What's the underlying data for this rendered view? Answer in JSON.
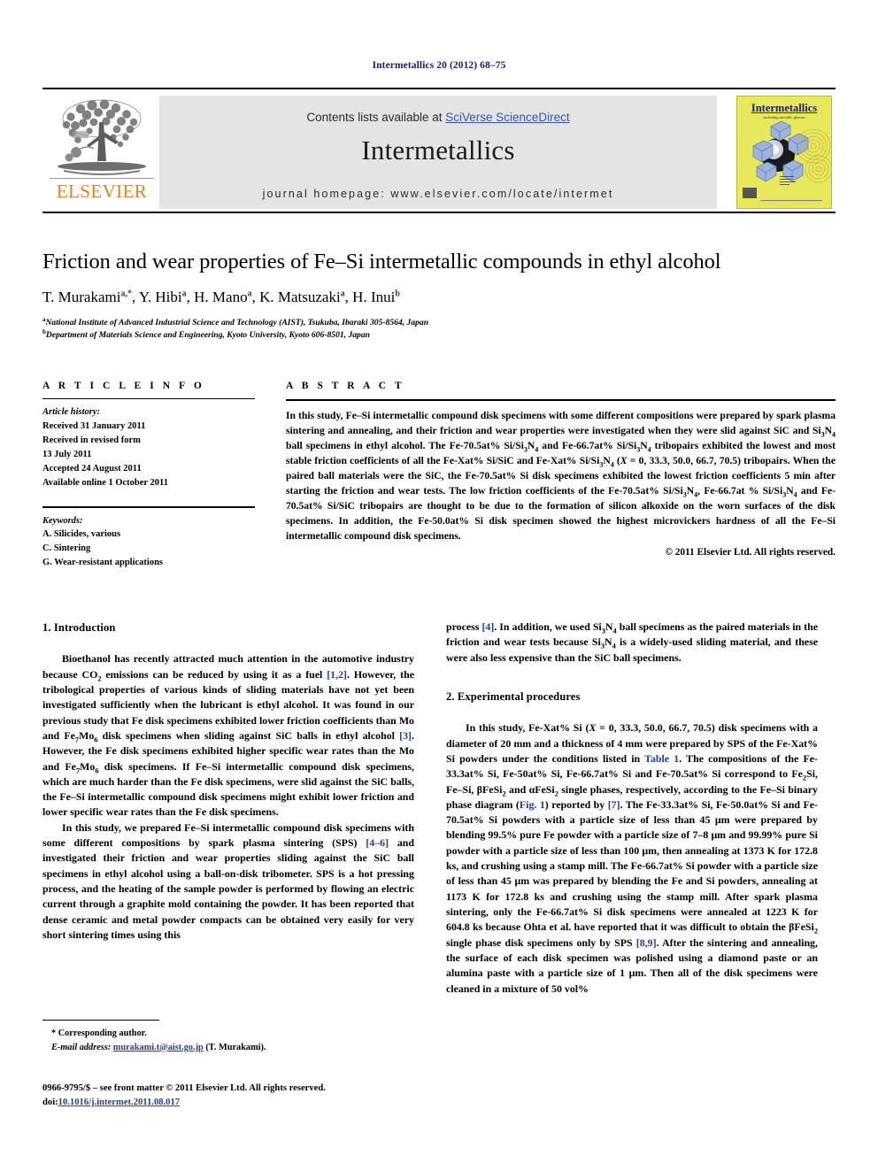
{
  "running_head": "Intermetallics 20 (2012) 68–75",
  "banner": {
    "contents_prefix": "Contents lists available at ",
    "contents_link": "SciVerse ScienceDirect",
    "journal_name": "Intermetallics",
    "homepage": "journal homepage: www.elsevier.com/locate/intermet",
    "publisher_name": "ELSEVIER",
    "cover_title": "Intermetallics",
    "cover_subtitle": "including metallic glasses"
  },
  "title": "Friction and wear properties of Fe–Si intermetallic compounds in ethyl alcohol",
  "authors": [
    {
      "name": "T. Murakami",
      "marks": "a,*"
    },
    {
      "name": "Y. Hibi",
      "marks": "a"
    },
    {
      "name": "H. Mano",
      "marks": "a"
    },
    {
      "name": "K. Matsuzaki",
      "marks": "a"
    },
    {
      "name": "H. Inui",
      "marks": "b"
    }
  ],
  "affiliations": [
    {
      "mark": "a",
      "text": "National Institute of Advanced Industrial Science and Technology (AIST), Tsukuba, Ibaraki 305-8564, Japan"
    },
    {
      "mark": "b",
      "text": "Department of Materials Science and Engineering, Kyoto University, Kyoto 606-8501, Japan"
    }
  ],
  "article_info": {
    "heading": "A R T I C L E   I N F O",
    "history_label": "Article history:",
    "history": [
      "Received 31 January 2011",
      "Received in revised form",
      "13 July 2011",
      "Accepted 24 August 2011",
      "Available online 1 October 2011"
    ],
    "keywords_label": "Keywords:",
    "keywords": [
      "A. Silicides, various",
      "C. Sintering",
      "G. Wear-resistant applications"
    ]
  },
  "abstract": {
    "heading": "A B S T R A C T",
    "copyright": "© 2011 Elsevier Ltd. All rights reserved."
  },
  "sections": {
    "introduction_heading": "1. Introduction",
    "experimental_heading": "2. Experimental procedures"
  },
  "footnote": {
    "corresponding": "* Corresponding author.",
    "email_label": "E-mail address:",
    "email": "murakami.t@aist.go.jp",
    "email_suffix": "(T. Murakami).",
    "issn_line": "0966-9795/$ – see front matter © 2011 Elsevier Ltd. All rights reserved.",
    "doi_label": "doi:",
    "doi": "10.1016/j.intermet.2011.08.017"
  },
  "colors": {
    "link": "#1f3d99",
    "running_head": "#19216c",
    "elsevier_orange": "#f07f19",
    "cover_yellow": "#e8e85c",
    "panel_grey": "#e4e4e4"
  }
}
